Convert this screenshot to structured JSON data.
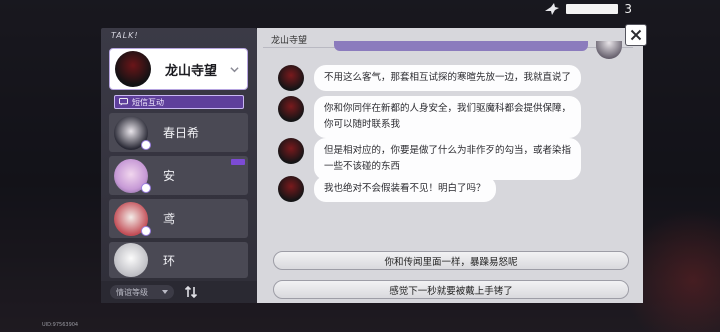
{
  "hud": {
    "count": "3",
    "bird_icon": "crow-icon"
  },
  "uid_text": "UID:97563904",
  "sidebar": {
    "title": "TALK!",
    "selected_contact": {
      "name": "龙山寺望",
      "icon": "chevron-down-icon"
    },
    "sub_tab": {
      "label": "短信互动",
      "icon": "chat-icon"
    },
    "contacts": [
      {
        "name": "春日希"
      },
      {
        "name": "安",
        "has_new": true
      },
      {
        "name": "鸢"
      },
      {
        "name": "环"
      }
    ],
    "sort": {
      "label": "情谊等级",
      "toggle_icon": "sort-toggle-icon"
    }
  },
  "chat": {
    "title": "龙山寺望",
    "messages": [
      {
        "lines": [
          "不用这么客气，那套相互试探的寒暄先放一边，我就直说了"
        ]
      },
      {
        "lines": [
          "你和你同伴在新都的人身安全，我们驱魔科都会提供保障，",
          "你可以随时联系我"
        ]
      },
      {
        "lines": [
          "但是相对应的，你要是做了什么为非作歹的勾当，或者染指",
          "一些不该碰的东西"
        ]
      },
      {
        "lines": [
          "我也绝对不会假装看不见！明白了吗？"
        ]
      }
    ],
    "choices": [
      {
        "label": "你和传闻里面一样，暴躁易怒呢"
      },
      {
        "label": "感觉下一秒就要被戴上手铐了"
      }
    ]
  },
  "close_icon": "close-icon",
  "colors": {
    "accent": "#5e3f9b",
    "panel": "#d7d7dc",
    "bubble": "#fdfdfe"
  }
}
